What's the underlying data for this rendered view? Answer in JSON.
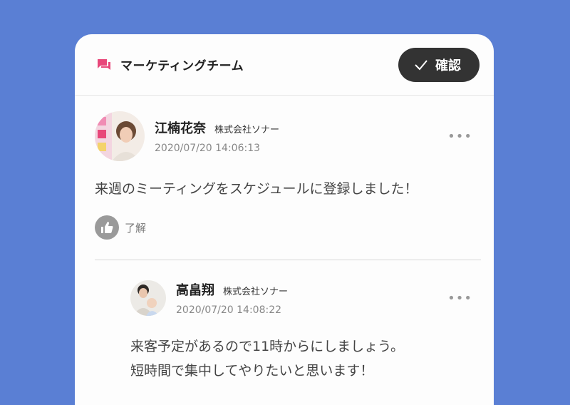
{
  "header": {
    "icon": "chat-icon",
    "title": "マーケティングチーム",
    "confirm_label": "確認"
  },
  "posts": [
    {
      "author": "江楠花奈",
      "company": "株式会社ソナー",
      "timestamp": "2020/07/20 14:06:13",
      "text": "来週のミーティングをスケジュールに登録しました！",
      "like_label": "了解"
    },
    {
      "author": "高畠翔",
      "company": "株式会社ソナー",
      "timestamp": "2020/07/20 14:08:22",
      "text_lines": [
        "来客予定があるので11時からにしましょう。",
        "短時間で集中してやりたいと思います！"
      ]
    }
  ],
  "colors": {
    "background": "#5a7fd4",
    "accent_pink": "#e8477a",
    "button_dark": "#333333"
  }
}
